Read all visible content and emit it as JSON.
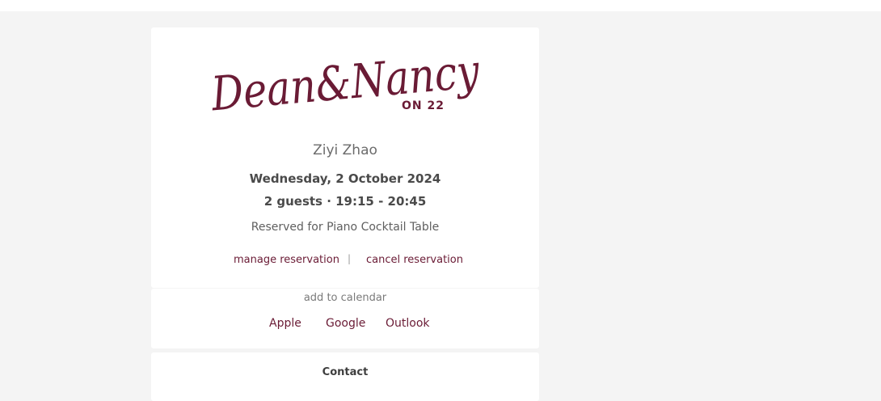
{
  "brand": {
    "logo_main": "Dean&Nancy",
    "logo_sub": "ON 22",
    "logo_color": "#6a1b35"
  },
  "reservation": {
    "guest_name": "Ziyi Zhao",
    "date": "Wednesday, 2 October 2024",
    "time_line": "2 guests · 19:15 - 20:45",
    "table": "Reserved for Piano Cocktail Table"
  },
  "actions": {
    "manage_label": "manage reservation",
    "separator": "|",
    "cancel_label": "cancel reservation"
  },
  "calendar": {
    "label": "add to calendar",
    "apple": "Apple",
    "google": "Google",
    "outlook": "Outlook"
  },
  "contact": {
    "title": "Contact"
  },
  "colors": {
    "background": "#f4f4f4",
    "card": "#ffffff",
    "accent": "#6a1b35",
    "text_dark": "#4a4a4a"
  }
}
